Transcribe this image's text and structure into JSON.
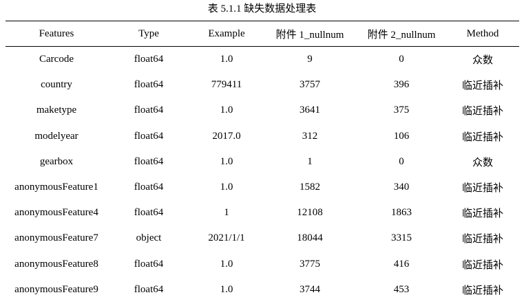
{
  "caption": "表 5.1.1 缺失数据处理表",
  "table": {
    "headers": [
      "Features",
      "Type",
      "Example",
      "附件 1_nullnum",
      "附件 2_nullnum",
      "Method"
    ],
    "rows": [
      [
        "Carcode",
        "float64",
        "1.0",
        "9",
        "0",
        "众数"
      ],
      [
        "country",
        "float64",
        "779411",
        "3757",
        "396",
        "临近插补"
      ],
      [
        "maketype",
        "float64",
        "1.0",
        "3641",
        "375",
        "临近插补"
      ],
      [
        "modelyear",
        "float64",
        "2017.0",
        "312",
        "106",
        "临近插补"
      ],
      [
        "gearbox",
        "float64",
        "1.0",
        "1",
        "0",
        "众数"
      ],
      [
        "anonymousFeature1",
        "float64",
        "1.0",
        "1582",
        "340",
        "临近插补"
      ],
      [
        "anonymousFeature4",
        "float64",
        "1",
        "12108",
        "1863",
        "临近插补"
      ],
      [
        "anonymousFeature7",
        "object",
        "2021/1/1",
        "18044",
        "3315",
        "临近插补"
      ],
      [
        "anonymousFeature8",
        "float64",
        "1.0",
        "3775",
        "416",
        "临近插补"
      ],
      [
        "anonymousFeature9",
        "float64",
        "1.0",
        "3744",
        "453",
        "临近插补"
      ]
    ]
  }
}
